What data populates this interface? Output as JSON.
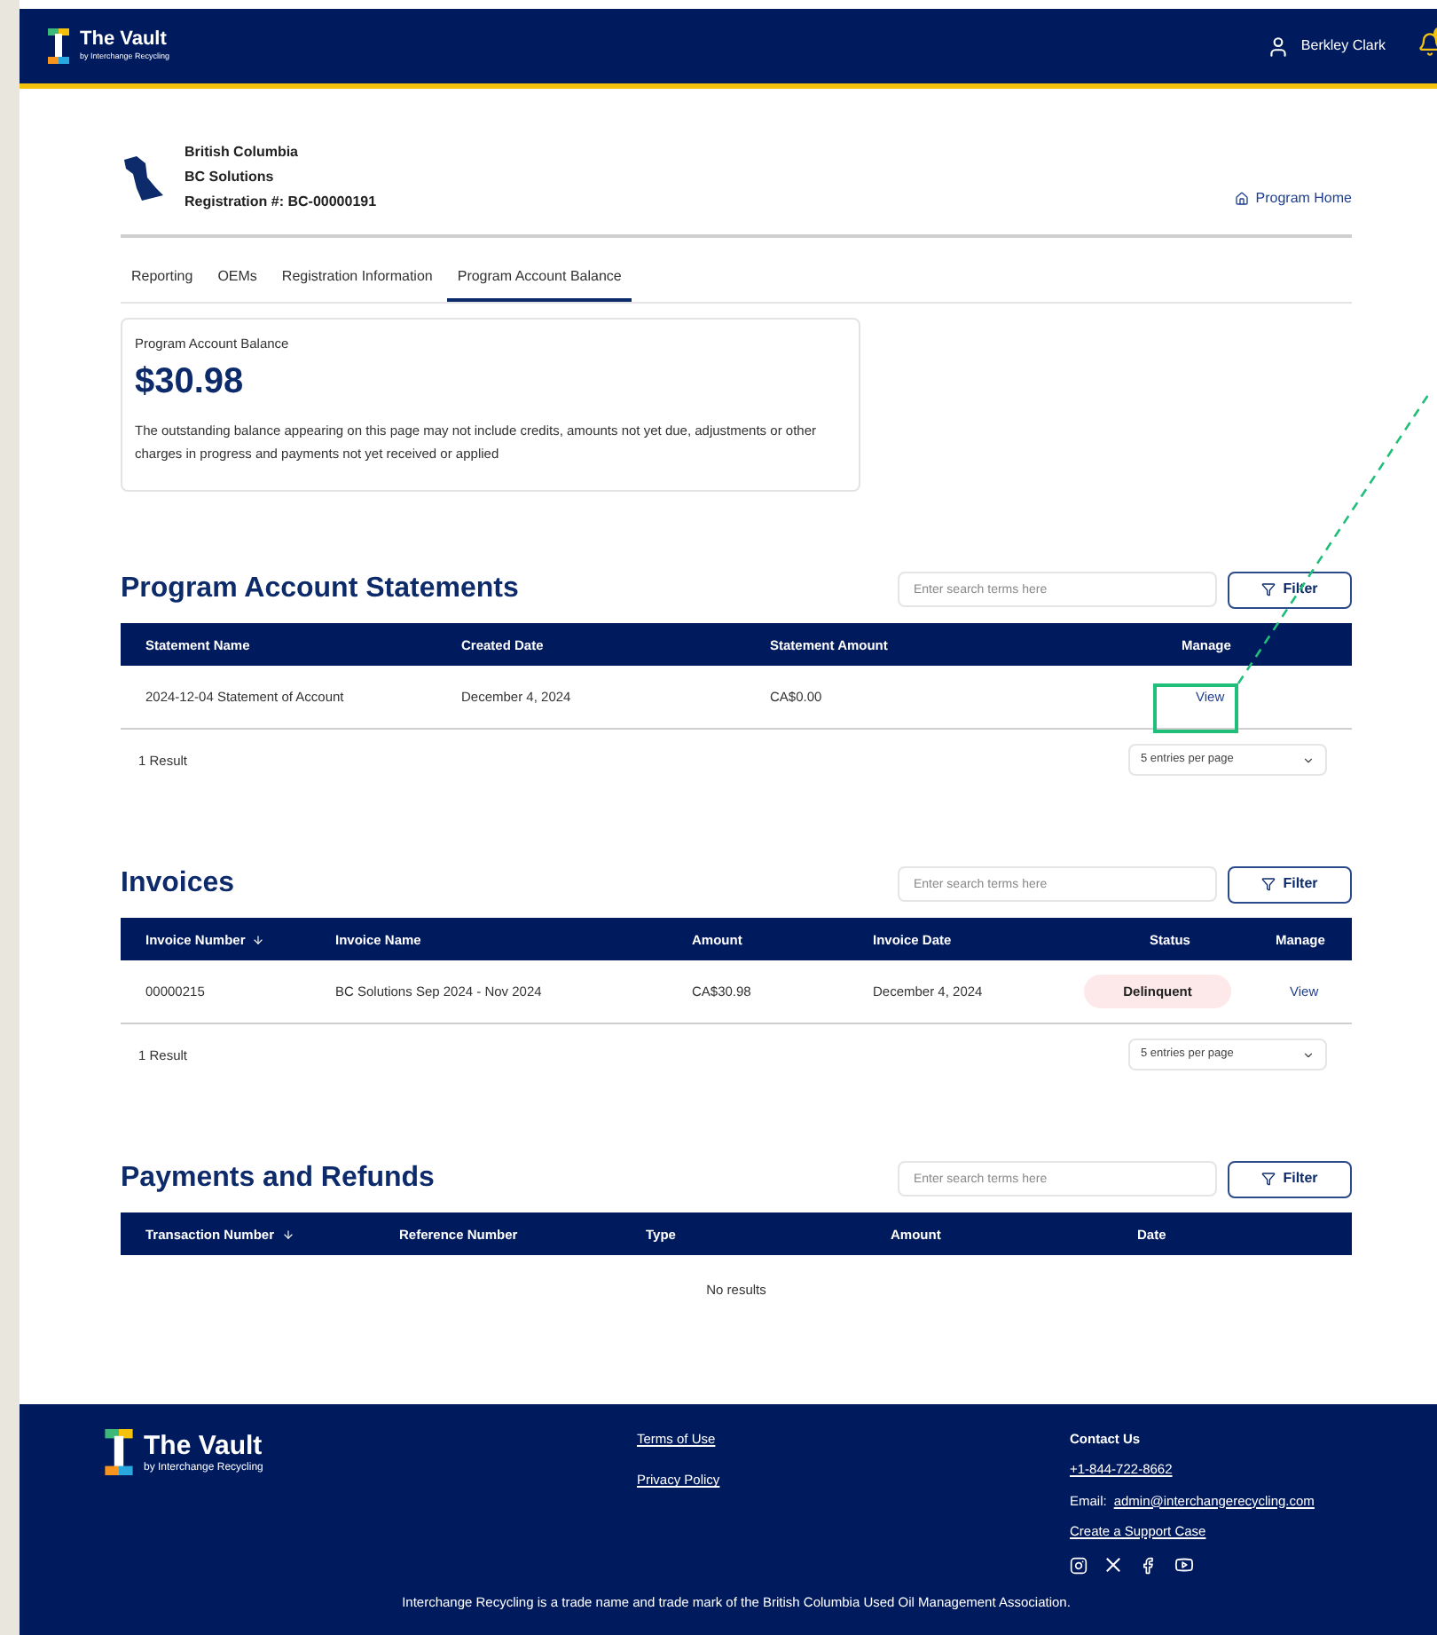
{
  "header": {
    "logo_title": "The Vault",
    "logo_subtitle": "by Interchange Recycling",
    "user_name": "Berkley Clark",
    "notifications": true
  },
  "program": {
    "province": "British Columbia",
    "company": "BC Solutions",
    "registration": "Registration #: BC-00000191",
    "home_link": "Program Home"
  },
  "tabs": [
    {
      "label": "Reporting",
      "selected": false
    },
    {
      "label": "OEMs",
      "selected": false
    },
    {
      "label": "Registration Information",
      "selected": false
    },
    {
      "label": "Program Account Balance",
      "selected": true
    }
  ],
  "balance": {
    "label": "Program Account Balance",
    "amount": "$30.98",
    "note": "The outstanding balance appearing on this page may not include credits, amounts not yet due, adjustments or other charges in progress and payments not yet received or applied"
  },
  "sections": [
    {
      "title": "Program Account Statements",
      "search_placeholder": "Enter search terms here",
      "filter_label": "Filter",
      "columns": [
        {
          "label": "Statement Name",
          "sortable": false,
          "kind": "text"
        },
        {
          "label": "Created Date",
          "sortable": false,
          "kind": "text"
        },
        {
          "label": "Statement Amount",
          "sortable": false,
          "kind": "text"
        },
        {
          "label": "Manage",
          "sortable": false,
          "kind": "link"
        }
      ],
      "rows": [
        [
          "2024-12-04 Statement of Account",
          "December 4, 2024",
          "CA$0.00",
          "View"
        ]
      ],
      "result_count": "1 Result",
      "page_size": "5 entries per page"
    },
    {
      "title": "Invoices",
      "search_placeholder": "Enter search terms here",
      "filter_label": "Filter",
      "columns": [
        {
          "label": "Invoice Number",
          "sortable": true,
          "kind": "text"
        },
        {
          "label": "Invoice Name",
          "sortable": false,
          "kind": "text"
        },
        {
          "label": "Amount",
          "sortable": false,
          "kind": "text"
        },
        {
          "label": "Invoice Date",
          "sortable": false,
          "kind": "text"
        },
        {
          "label": "Status",
          "sortable": false,
          "kind": "badge"
        },
        {
          "label": "Manage",
          "sortable": false,
          "kind": "link"
        }
      ],
      "rows": [
        [
          "00000215",
          "BC Solutions Sep 2024 - Nov 2024",
          "CA$30.98",
          "December 4, 2024",
          "Delinquent",
          "View"
        ]
      ],
      "result_count": "1 Result",
      "page_size": "5 entries per page"
    },
    {
      "title": "Payments and Refunds",
      "search_placeholder": "Enter search terms here",
      "filter_label": "Filter",
      "columns": [
        {
          "label": "Transaction Number",
          "sortable": true,
          "kind": "text"
        },
        {
          "label": "Reference Number",
          "sortable": false,
          "kind": "text"
        },
        {
          "label": "Type",
          "sortable": false,
          "kind": "text"
        },
        {
          "label": "Amount",
          "sortable": false,
          "kind": "text"
        },
        {
          "label": "Date",
          "sortable": false,
          "kind": "text"
        }
      ],
      "empty_text": "No results"
    }
  ],
  "annotation": {
    "highlight": true
  },
  "footer": {
    "logo_title": "The Vault",
    "logo_subtitle": "by Interchange Recycling",
    "links": [
      "Terms of Use",
      "Privacy Policy"
    ],
    "contact_title": "Contact Us",
    "phone": "+1-844-722-8662",
    "email_label": "Email:",
    "email": "admin@interchangerecycling.com",
    "support_link": "Create a Support Case",
    "legal": "Interchange Recycling is a trade name and trade mark of the British Columbia Used Oil Management Association."
  }
}
